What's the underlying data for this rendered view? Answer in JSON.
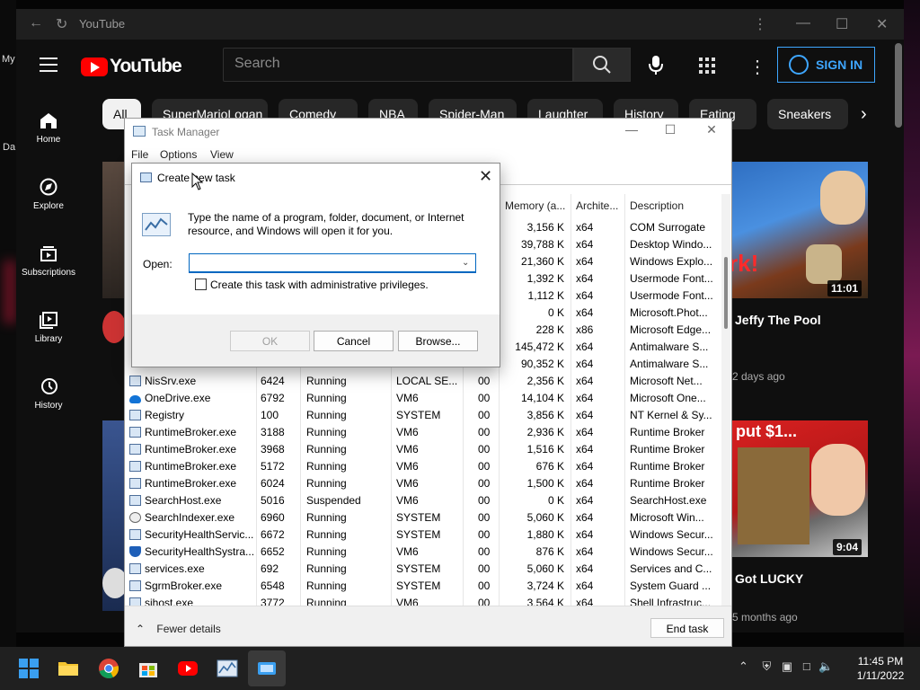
{
  "desktop": {
    "left_labels": [
      "My",
      "Da"
    ]
  },
  "youtube": {
    "window_title": "YouTube",
    "logo_text": "YouTube",
    "search_placeholder": "Search",
    "sign_in_label": "SIGN IN",
    "sidebar": [
      {
        "label": "Home",
        "icon": "home-icon"
      },
      {
        "label": "Explore",
        "icon": "compass-icon"
      },
      {
        "label": "Subscriptions",
        "icon": "subscriptions-icon"
      },
      {
        "label": "Library",
        "icon": "library-icon"
      },
      {
        "label": "History",
        "icon": "history-icon"
      }
    ],
    "chips": [
      "All",
      "SuperMarioLogan",
      "Comedy",
      "NBA",
      "Spider-Man",
      "Laughter",
      "History",
      "Eating",
      "Sneakers"
    ],
    "videos": [
      {
        "title": "Jeffy The Pool",
        "meta": "2 days ago",
        "duration": "11:01",
        "thumb_text": "rk!"
      },
      {
        "title": "Got LUCKY",
        "meta": "5 months ago",
        "duration": "9:04",
        "thumb_text": "put $1..."
      }
    ]
  },
  "task_manager": {
    "title": "Task Manager",
    "menu": [
      "File",
      "Options",
      "View"
    ],
    "columns": {
      "memory": "Memory (a...",
      "arch": "Archite...",
      "desc": "Description"
    },
    "top_rows": [
      {
        "memory": "3,156 K",
        "arch": "x64",
        "desc": "COM Surrogate"
      },
      {
        "memory": "39,788 K",
        "arch": "x64",
        "desc": "Desktop Windo..."
      },
      {
        "memory": "21,360 K",
        "arch": "x64",
        "desc": "Windows Explo..."
      },
      {
        "memory": "1,392 K",
        "arch": "x64",
        "desc": "Usermode Font..."
      },
      {
        "memory": "1,112 K",
        "arch": "x64",
        "desc": "Usermode Font..."
      },
      {
        "memory": "0 K",
        "arch": "x64",
        "desc": "Microsoft.Phot..."
      },
      {
        "memory": "228 K",
        "arch": "x86",
        "desc": "Microsoft Edge..."
      },
      {
        "memory": "145,472 K",
        "arch": "x64",
        "desc": "Antimalware S..."
      },
      {
        "memory": "90,352 K",
        "arch": "x64",
        "desc": "Antimalware S..."
      }
    ],
    "rows": [
      {
        "name": "NisSrv.exe",
        "pid": "6424",
        "status": "Running",
        "user": "LOCAL SE...",
        "cpu": "00",
        "memory": "2,356 K",
        "arch": "x64",
        "desc": "Microsoft Net...",
        "icon": "window"
      },
      {
        "name": "OneDrive.exe",
        "pid": "6792",
        "status": "Running",
        "user": "VM6",
        "cpu": "00",
        "memory": "14,104 K",
        "arch": "x64",
        "desc": "Microsoft One...",
        "icon": "cloud"
      },
      {
        "name": "Registry",
        "pid": "100",
        "status": "Running",
        "user": "SYSTEM",
        "cpu": "00",
        "memory": "3,856 K",
        "arch": "x64",
        "desc": "NT Kernel & Sy...",
        "icon": "window"
      },
      {
        "name": "RuntimeBroker.exe",
        "pid": "3188",
        "status": "Running",
        "user": "VM6",
        "cpu": "00",
        "memory": "2,936 K",
        "arch": "x64",
        "desc": "Runtime Broker",
        "icon": "window"
      },
      {
        "name": "RuntimeBroker.exe",
        "pid": "3968",
        "status": "Running",
        "user": "VM6",
        "cpu": "00",
        "memory": "1,516 K",
        "arch": "x64",
        "desc": "Runtime Broker",
        "icon": "window"
      },
      {
        "name": "RuntimeBroker.exe",
        "pid": "5172",
        "status": "Running",
        "user": "VM6",
        "cpu": "00",
        "memory": "676 K",
        "arch": "x64",
        "desc": "Runtime Broker",
        "icon": "window"
      },
      {
        "name": "RuntimeBroker.exe",
        "pid": "6024",
        "status": "Running",
        "user": "VM6",
        "cpu": "00",
        "memory": "1,500 K",
        "arch": "x64",
        "desc": "Runtime Broker",
        "icon": "window"
      },
      {
        "name": "SearchHost.exe",
        "pid": "5016",
        "status": "Suspended",
        "user": "VM6",
        "cpu": "00",
        "memory": "0 K",
        "arch": "x64",
        "desc": "SearchHost.exe",
        "icon": "window"
      },
      {
        "name": "SearchIndexer.exe",
        "pid": "6960",
        "status": "Running",
        "user": "SYSTEM",
        "cpu": "00",
        "memory": "5,060 K",
        "arch": "x64",
        "desc": "Microsoft Win...",
        "icon": "magn"
      },
      {
        "name": "SecurityHealthServic...",
        "pid": "6672",
        "status": "Running",
        "user": "SYSTEM",
        "cpu": "00",
        "memory": "1,880 K",
        "arch": "x64",
        "desc": "Windows Secur...",
        "icon": "window"
      },
      {
        "name": "SecurityHealthSystra...",
        "pid": "6652",
        "status": "Running",
        "user": "VM6",
        "cpu": "00",
        "memory": "876 K",
        "arch": "x64",
        "desc": "Windows Secur...",
        "icon": "shield"
      },
      {
        "name": "services.exe",
        "pid": "692",
        "status": "Running",
        "user": "SYSTEM",
        "cpu": "00",
        "memory": "5,060 K",
        "arch": "x64",
        "desc": "Services and C...",
        "icon": "window"
      },
      {
        "name": "SgrmBroker.exe",
        "pid": "6548",
        "status": "Running",
        "user": "SYSTEM",
        "cpu": "00",
        "memory": "3,724 K",
        "arch": "x64",
        "desc": "System Guard ...",
        "icon": "window"
      },
      {
        "name": "sihost.exe",
        "pid": "3772",
        "status": "Running",
        "user": "VM6",
        "cpu": "00",
        "memory": "3,564 K",
        "arch": "x64",
        "desc": "Shell Infrastruc...",
        "icon": "window"
      }
    ],
    "fewer_details": "Fewer details",
    "end_task": "End task"
  },
  "dialog": {
    "title": "Create new task",
    "message": "Type the name of a program, folder, document, or Internet resource, and Windows will open it for you.",
    "open_label": "Open:",
    "open_value": "",
    "admin_label": "Create this task with administrative privileges.",
    "ok": "OK",
    "cancel": "Cancel",
    "browse": "Browse..."
  },
  "taskbar": {
    "time": "11:45 PM",
    "date": "1/11/2022"
  }
}
